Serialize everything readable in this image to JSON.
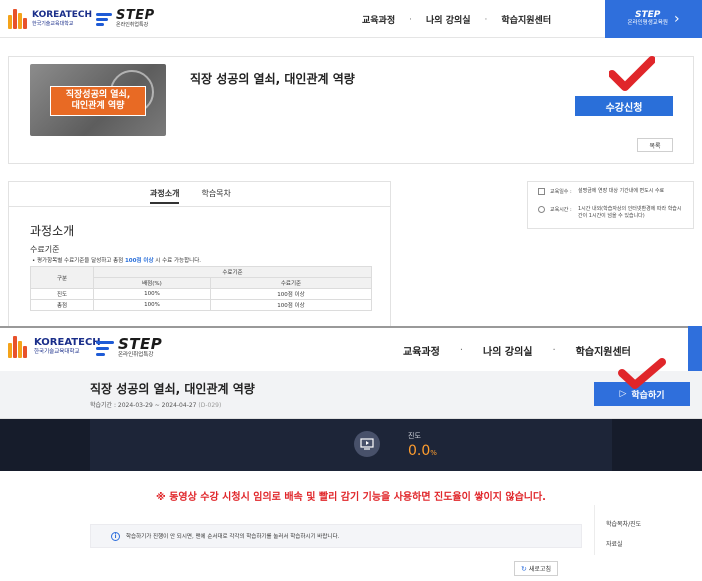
{
  "top": {
    "brand_name": "KOREATECH",
    "brand_sub": "한국기술교육대학교",
    "step_name": "STEP",
    "step_sub": "온라인취업특강",
    "nav": [
      "교육과정",
      "나의 강의실",
      "학습지원센터"
    ],
    "nav_separator": "·",
    "corner_button": {
      "title": "STEP",
      "sub": "온라인평생교육원"
    },
    "course_title": "직장 성공의 열쇠, 대인관계 역량",
    "thumbnail_text": [
      "직장성공의 열쇠,",
      "대인관계 역량"
    ],
    "apply_button": "수강신청",
    "list_button": "목록",
    "tabs": [
      "과정소개",
      "학습목차"
    ],
    "section_title": "과정소개",
    "criteria_label": "수료기준",
    "criteria_note": "• 평가항목별 수료기준을 달성하고 총점",
    "criteria_note_highlight": "100점 이상",
    "criteria_note_tail": "시 수료 가능합니다.",
    "criteria_table": {
      "header_item": "구분",
      "header_group": "수료기준",
      "header_cols": [
        "배점(%)",
        "수료기준"
      ],
      "rows": [
        {
          "item": "진도",
          "weight": "100%",
          "criterion": "100점 이상"
        },
        {
          "item": "총점",
          "weight": "100%",
          "criterion": "100점 이상"
        }
      ]
    },
    "info": [
      {
        "key": "교육일수 :",
        "value": "설명금에 연장 대상 기간내에 면도시 수료"
      },
      {
        "key": "교육시간 :",
        "value": "1시간 내외(학습자상의 인터넷환경에 따라 학습시간이 1시간이 넘을 수 있습니다)"
      }
    ]
  },
  "bottom": {
    "brand_name": "KOREATECH",
    "brand_sub": "한국기술교육대학교",
    "step_name": "STEP",
    "step_sub": "온라인취업특강",
    "nav": [
      "교육과정",
      "나의 강의실",
      "학습지원센터"
    ],
    "nav_separator": "·",
    "course_title": "직장 성공의 열쇠, 대인관계 역량",
    "period_label": "학습기간 : 2024-03-29 ~ 2024-04-27",
    "period_code": "(D-029)",
    "study_button": "학습하기",
    "progress_label": "진도",
    "progress_value": "0.0",
    "progress_unit": "%",
    "warning": "※ 동영상 수강 시청시 임의로 배속 및 빨리 감기 기능을 사용하면 진도율이 쌓이지 않습니다.",
    "notice": "학습하기가 진행이 안 되시면, 맨에 순서대로 각각의 학습하기를 눌러서 학습하시기 바랍니다.",
    "side_links": [
      "학습목차/진도",
      "자료실"
    ],
    "refresh_button": "새로고침"
  },
  "colors": {
    "accent": "#2f6fdc",
    "check": "#e0262a",
    "warning": "#e0262a",
    "progress_value": "#ff9d2e",
    "dark_band": "#1d2538"
  },
  "icons": [
    "koreatech-logo-icon",
    "step-logo-icon",
    "chevron-right-icon",
    "checkmark-icon",
    "play-icon",
    "video-icon",
    "info-icon",
    "refresh-icon",
    "calendar-icon",
    "clock-icon"
  ]
}
